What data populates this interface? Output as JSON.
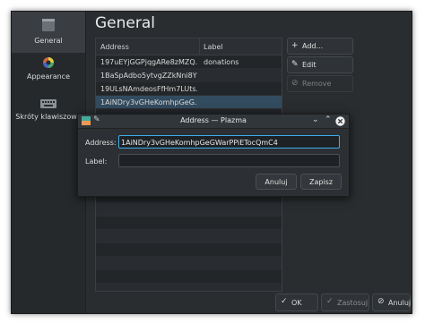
{
  "sidebar": {
    "items": [
      {
        "label": "General",
        "icon": "general-settings-icon"
      },
      {
        "label": "Appearance",
        "icon": "color-wheel-icon"
      },
      {
        "label": "Skróty klawiszowe",
        "icon": "keyboard-icon"
      }
    ]
  },
  "page": {
    "title": "General"
  },
  "table": {
    "columns": [
      "Address",
      "Label"
    ],
    "rows": [
      {
        "address": "197uEYjGGPjqgARe8zMZQ...",
        "label": "donations"
      },
      {
        "address": "1BaSpAdbo5ytvgZZkNni8YL...",
        "label": ""
      },
      {
        "address": "19ULsNAmdeosFfHm7LUts...",
        "label": ""
      },
      {
        "address": "1AiNDry3vGHeKomhpGeG...",
        "label": ""
      }
    ]
  },
  "actions": {
    "add": "Add...",
    "edit": "Edit",
    "remove": "Remove"
  },
  "footer": {
    "ok": "OK",
    "apply": "Zastosuj",
    "cancel": "Anuluj"
  },
  "dialog": {
    "title": "Address — Plazma",
    "address_label": "Address:",
    "address_value": "1AiNDry3vGHeKomhpGeGWarPPiETocQmC4",
    "label_label": "Label:",
    "label_value": "",
    "cancel": "Anuluj",
    "save": "Zapisz"
  },
  "colors": {
    "accent": "#3daee9",
    "selection": "#334b5e",
    "window_bg": "#2a2d30",
    "close_button": "#f0f0f0"
  }
}
